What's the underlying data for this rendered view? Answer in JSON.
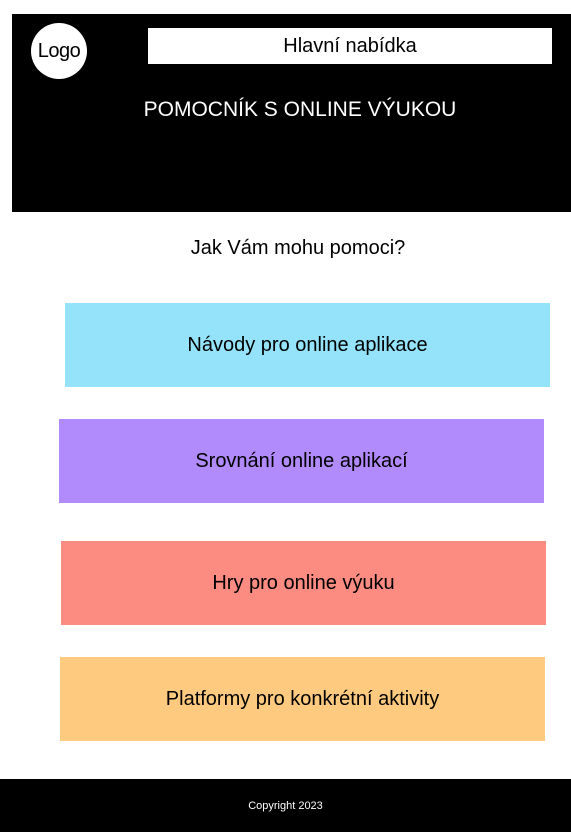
{
  "header": {
    "logo_label": "Logo",
    "menu_label": "Hlavní nabídka",
    "site_title": "POMOCNÍK S ONLINE VÝUKOU",
    "background": "#000000"
  },
  "main": {
    "question": "Jak Vám mohu pomoci?",
    "cards": [
      {
        "label": "Návody pro online aplikace",
        "color": "#94E3FB"
      },
      {
        "label": "Srovnání online aplikací",
        "color": "#B18AFB"
      },
      {
        "label": "Hry pro online výuku",
        "color": "#FC8B82"
      },
      {
        "label": "Platformy pro konkrétní aktivity",
        "color": "#FECA7F"
      }
    ]
  },
  "footer": {
    "copyright": "Copyright 2023"
  }
}
